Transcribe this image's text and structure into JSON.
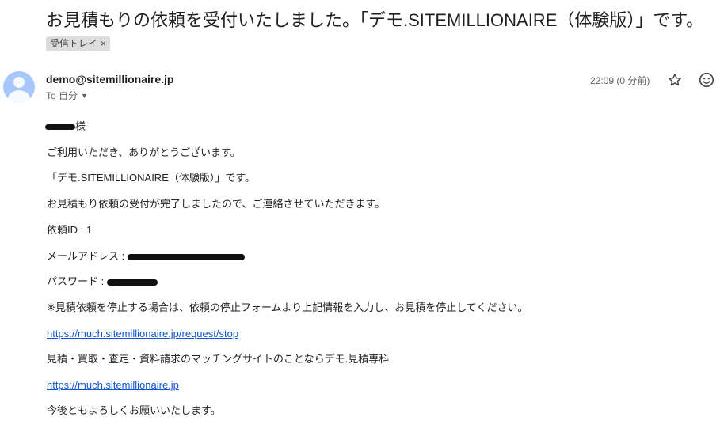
{
  "email": {
    "subject": "お見積もりの依頼を受付いたしました。「デモ.SITEMILLIONAIRE（体験版）」です。",
    "label": "受信トレイ",
    "label_remove": "×",
    "sender": "demo@sitemillionaire.jp",
    "to_label": "To 自分",
    "time": "22:09 (0 分前)"
  },
  "body": {
    "greeting_suffix": "様",
    "line1": "ご利用いただき、ありがとうございます。",
    "line2": "「デモ.SITEMILLIONAIRE（体験版）」です。",
    "line3": "お見積もり依頼の受付が完了しましたので、ご連絡させていただきます。",
    "request_id": "依頼ID : 1",
    "mail_label": "メールアドレス : ",
    "password_label": "パスワード : ",
    "notice": "※見積依頼を停止する場合は、依頼の停止フォームより上記情報を入力し、お見積を停止してください。",
    "stop_link": "https://much.sitemillionaire.jp/request/stop",
    "tagline": "見積・買取・査定・資料請求のマッチングサイトのことならデモ.見積専科",
    "site_link": "https://much.sitemillionaire.jp",
    "closing": "今後ともよろしくお願いいたします。"
  },
  "icons": {
    "star": "star-icon",
    "emoji": "emoji-icon",
    "avatar": "avatar"
  }
}
